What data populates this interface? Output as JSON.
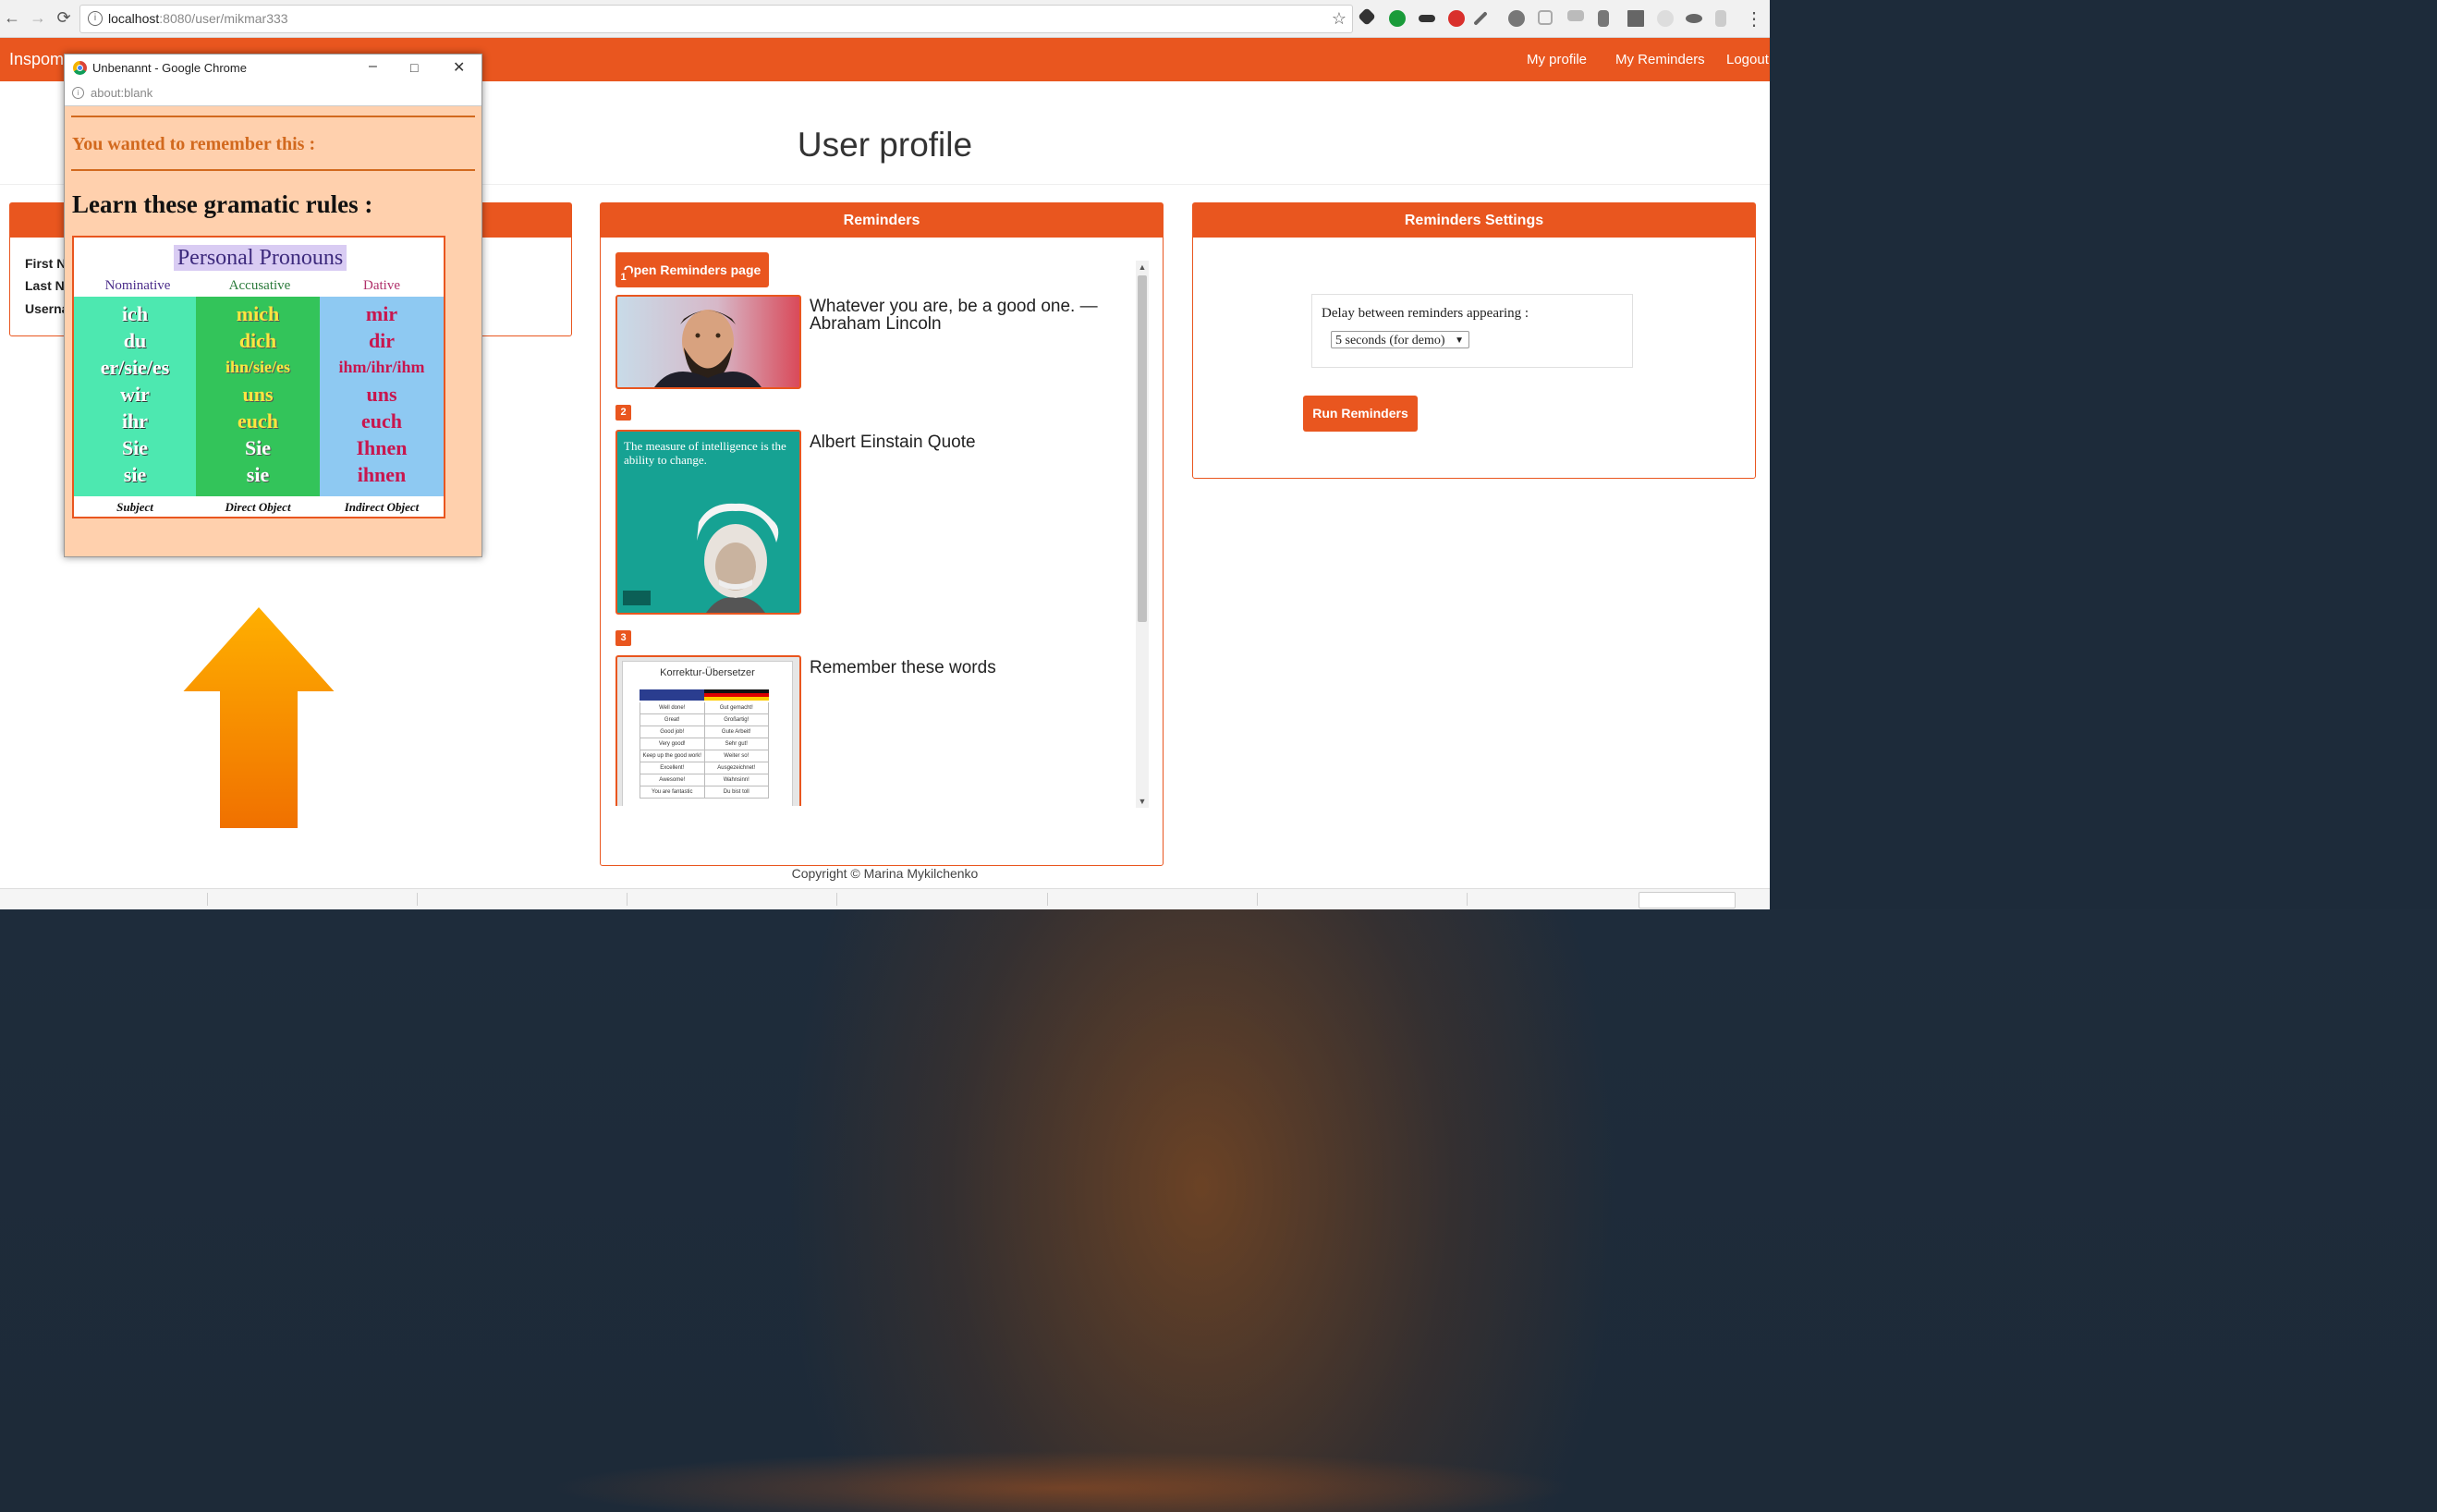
{
  "browser": {
    "url_host": "localhost",
    "url_path": ":8080/user/mikmar333",
    "nav": {
      "back": "←",
      "forward": "→",
      "reload": "⟳"
    }
  },
  "app": {
    "brand": "Inspom",
    "nav": [
      "My profile",
      "My Reminders",
      "Logout"
    ],
    "page_title": "User profile"
  },
  "profile_panel": {
    "labels": [
      "First N",
      "Last N",
      "Userna"
    ]
  },
  "reminders_panel": {
    "title": "Reminders",
    "open_button": "Open Reminders page",
    "items": [
      {
        "num": "1",
        "text": "Whatever you are, be a good one. — Abraham Lincoln"
      },
      {
        "num": "2",
        "text": "Albert Einstain Quote",
        "image_text": "The measure of intelligence is the ability to change."
      },
      {
        "num": "3",
        "text": "Remember these words",
        "image_title": "Korrektur-Übersetzer",
        "table": [
          [
            "Well done!",
            "Gut gemacht!"
          ],
          [
            "Great!",
            "Großartig!"
          ],
          [
            "Good job!",
            "Gute Arbeit!"
          ],
          [
            "Very good!",
            "Sehr gut!"
          ],
          [
            "Keep up the good work!",
            "Weiter so!"
          ],
          [
            "Excellent!",
            "Ausgezeichnet!"
          ],
          [
            "Awesome!",
            "Wahnsinn!"
          ],
          [
            "You are fantastic",
            "Du bist toll"
          ]
        ]
      }
    ]
  },
  "settings_panel": {
    "title": "Reminders Settings",
    "delay_label": "Delay between reminders appearing :",
    "delay_value": "5 seconds (for demo)",
    "run_button": "Run Reminders"
  },
  "footer": {
    "copyright": "Copyright © Marina Mykilchenko"
  },
  "popup": {
    "window_title": "Unbenannt - Google Chrome",
    "url": "about:blank",
    "message": "You wanted to remember this :",
    "heading": "Learn these gramatic rules :",
    "card": {
      "title": "Personal Pronouns",
      "columns": [
        {
          "header": "Nominative",
          "footer": "Subject",
          "words": [
            "ich",
            "du",
            "er/sie/es",
            "wir",
            "ihr",
            "Sie",
            "sie"
          ]
        },
        {
          "header": "Accusative",
          "footer": "Direct Object",
          "words": [
            "mich",
            "dich",
            "ihn/sie/es",
            "uns",
            "euch",
            "Sie",
            "sie"
          ]
        },
        {
          "header": "Dative",
          "footer": "Indirect Object",
          "words": [
            "mir",
            "dir",
            "ihm/ihr/ihm",
            "uns",
            "euch",
            "Ihnen",
            "ihnen"
          ]
        }
      ]
    }
  },
  "colors": {
    "brand": "#e9561f",
    "popup_bg": "#ffd0ad",
    "accent_text": "#d2691e"
  },
  "icons": [
    "info-icon",
    "star-icon",
    "chrome-icon",
    "minimize-icon",
    "maximize-icon",
    "close-icon",
    "arrow-up-icon"
  ]
}
